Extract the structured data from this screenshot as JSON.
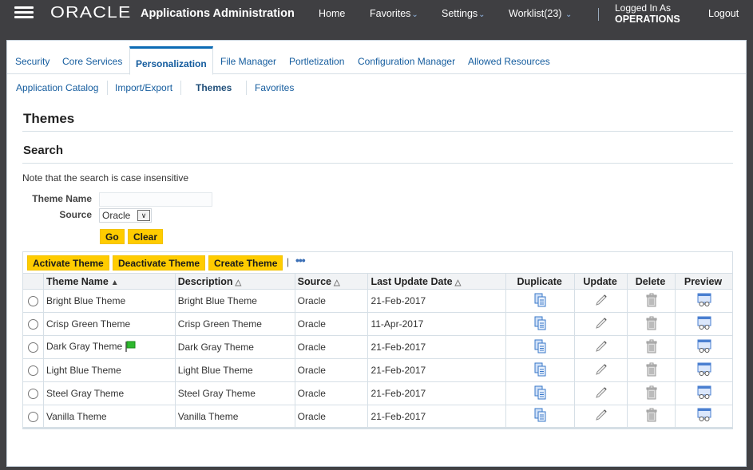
{
  "header": {
    "menu_icon": "hamburger-icon",
    "logo": "ORACLE",
    "app_title": "Applications Administration",
    "nav": [
      {
        "label": "Home",
        "has_dropdown": false
      },
      {
        "label": "Favorites",
        "has_dropdown": true
      },
      {
        "label": "Settings",
        "has_dropdown": true
      },
      {
        "label": "Worklist(23)",
        "has_dropdown": true
      }
    ],
    "dropdown_glyph": "⌄",
    "logged_in_label": "Logged In As",
    "logged_in_user": "OPERATIONS",
    "logout": "Logout"
  },
  "tabs": [
    {
      "label": "Security",
      "active": false
    },
    {
      "label": "Core Services",
      "active": false
    },
    {
      "label": "Personalization",
      "active": true
    },
    {
      "label": "File Manager",
      "active": false
    },
    {
      "label": "Portletization",
      "active": false
    },
    {
      "label": "Configuration Manager",
      "active": false
    },
    {
      "label": "Allowed Resources",
      "active": false
    }
  ],
  "subtabs": [
    {
      "label": "Application Catalog",
      "active": false
    },
    {
      "label": "Import/Export",
      "active": false
    },
    {
      "label": "Themes",
      "active": true
    },
    {
      "label": "Favorites",
      "active": false
    }
  ],
  "page_title": "Themes",
  "search": {
    "title": "Search",
    "note": "Note that the search is case insensitive",
    "theme_name_label": "Theme Name",
    "theme_name_value": "",
    "source_label": "Source",
    "source_value": "Oracle",
    "go": "Go",
    "clear": "Clear"
  },
  "toolbar": {
    "activate": "Activate Theme",
    "deactivate": "Deactivate Theme",
    "create": "Create Theme",
    "separator": "|",
    "more": "•••"
  },
  "table": {
    "columns": [
      {
        "label": "Theme Name",
        "sort": "ascending"
      },
      {
        "label": "Description",
        "sort": "none"
      },
      {
        "label": "Source",
        "sort": "none"
      },
      {
        "label": "Last Update Date",
        "sort": "none"
      },
      {
        "label": "Duplicate"
      },
      {
        "label": "Update"
      },
      {
        "label": "Delete"
      },
      {
        "label": "Preview"
      }
    ],
    "sort_asc_glyph": "▲",
    "sort_none_glyph": "△",
    "rows": [
      {
        "name": "Bright Blue Theme",
        "description": "Bright Blue Theme",
        "source": "Oracle",
        "date": "21-Feb-2017",
        "active": false
      },
      {
        "name": "Crisp Green Theme",
        "description": "Crisp Green Theme",
        "source": "Oracle",
        "date": "11-Apr-2017",
        "active": false
      },
      {
        "name": "Dark Gray Theme",
        "description": "Dark Gray Theme",
        "source": "Oracle",
        "date": "21-Feb-2017",
        "active": true
      },
      {
        "name": "Light Blue Theme",
        "description": "Light Blue Theme",
        "source": "Oracle",
        "date": "21-Feb-2017",
        "active": false
      },
      {
        "name": "Steel Gray Theme",
        "description": "Steel Gray Theme",
        "source": "Oracle",
        "date": "21-Feb-2017",
        "active": false
      },
      {
        "name": "Vanilla Theme",
        "description": "Vanilla Theme",
        "source": "Oracle",
        "date": "21-Feb-2017",
        "active": false
      }
    ]
  },
  "colors": {
    "header_bg": "#3f3f42",
    "accent_blue": "#0b6bb5",
    "link_blue": "#145c9e",
    "button_yellow": "#ffcc00",
    "flag_green": "#2db82d"
  }
}
